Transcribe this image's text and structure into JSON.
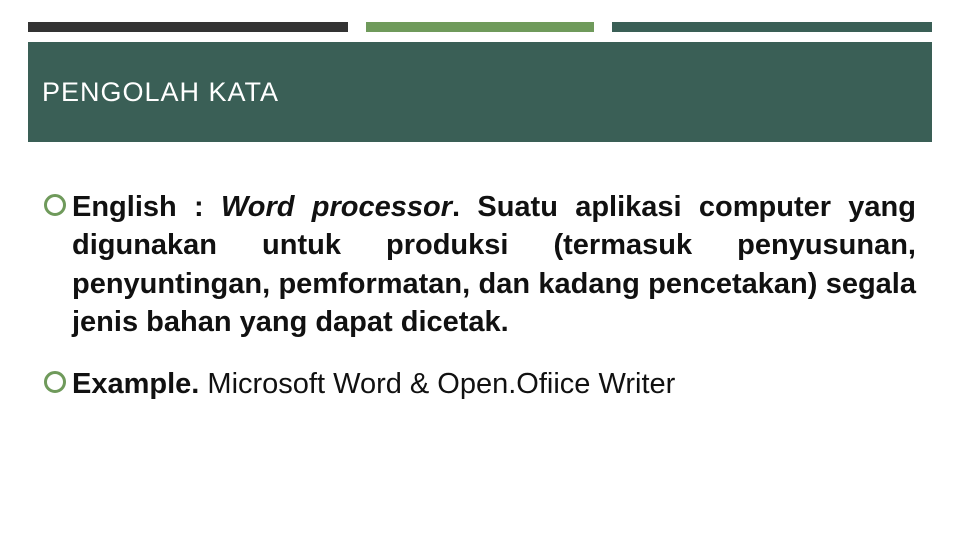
{
  "header": {
    "title": "PENGOLAH KATA"
  },
  "bullets": [
    {
      "prefix": "English : ",
      "term": "Word processor",
      "sep": ". ",
      "body": "Suatu aplikasi computer yang digunakan untuk produksi (termasuk penyusunan, penyuntingan, pemformatan, dan kadang pencetakan) segala jenis bahan yang dapat dicetak."
    },
    {
      "lead": "Example. ",
      "rest": "Microsoft Word & Open.Ofiice Writer"
    }
  ]
}
